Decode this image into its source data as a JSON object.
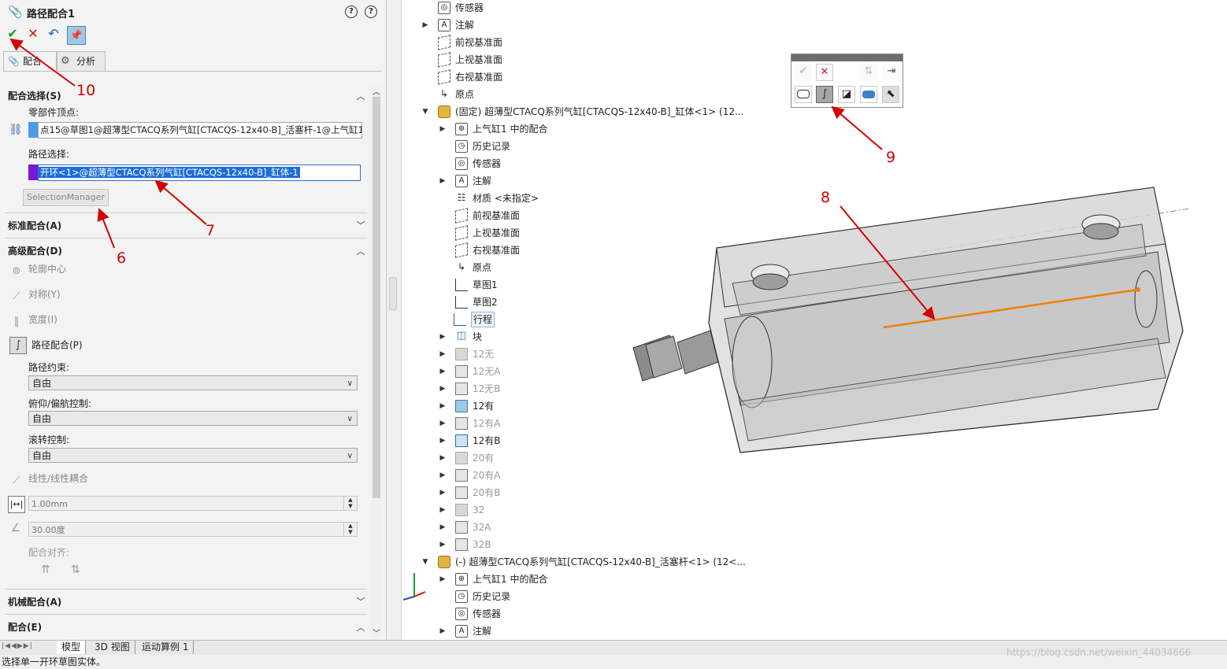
{
  "property_manager": {
    "title": "路径配合1",
    "toolbar": {
      "ok_icon": "check-icon",
      "cancel_icon": "close-icon",
      "undo_icon": "undo-icon",
      "pin_icon": "pushpin-icon"
    },
    "tabs": [
      {
        "label": "配合"
      },
      {
        "label": "分析"
      }
    ],
    "mate_selection": {
      "header": "配合选择(S)",
      "component_vertex_label": "零部件顶点:",
      "component_vertex_value": "点15@草图1@超薄型CTACQ系列气缸[CTACQS-12x40-B]_活塞杆-1@上气缸1",
      "path_label": "路径选择:",
      "path_value": "开环<1>@超薄型CTACQ系列气缸[CTACQS-12x40-B]_缸体-1",
      "selection_manager_label": "SelectionManager"
    },
    "standard_mates": {
      "header": "标准配合(A)"
    },
    "advanced_mates": {
      "header": "高级配合(D)",
      "items": [
        {
          "label": "轮廓中心"
        },
        {
          "label": "对称(Y)"
        },
        {
          "label": "宽度(I)"
        },
        {
          "label": "路径配合(P)"
        }
      ],
      "path_constraint_label": "路径约束:",
      "path_constraint_value": "自由",
      "pitch_yaw_label": "俯仰/偏航控制:",
      "pitch_yaw_value": "自由",
      "roll_label": "滚转控制:",
      "roll_value": "自由",
      "linear_coupler_label": "线性/线性耦合",
      "distance_value": "1.00mm",
      "angle_value": "30.00度",
      "mate_alignment_label": "配合对齐:"
    },
    "mechanical_mates": {
      "header": "机械配合(A)"
    },
    "mates": {
      "header": "配合(E)"
    }
  },
  "tree": {
    "top_items": [
      {
        "label": "传感器"
      },
      {
        "label": "注解"
      },
      {
        "label": "前视基准面"
      },
      {
        "label": "上视基准面"
      },
      {
        "label": "右视基准面"
      },
      {
        "label": "原点"
      }
    ],
    "component1": {
      "label": "(固定) 超薄型CTACQ系列气缸[CTACQS-12x40-B]_缸体<1> (12...",
      "children": [
        {
          "label": "上气缸1 中的配合"
        },
        {
          "label": "历史记录"
        },
        {
          "label": "传感器"
        },
        {
          "label": "注解"
        },
        {
          "label": "材质 <未指定>"
        },
        {
          "label": "前视基准面"
        },
        {
          "label": "上视基准面"
        },
        {
          "label": "右视基准面"
        },
        {
          "label": "原点"
        },
        {
          "label": "草图1"
        },
        {
          "label": "草图2"
        },
        {
          "label": "行程"
        },
        {
          "label": "块"
        },
        {
          "label": "12无"
        },
        {
          "label": "12无A"
        },
        {
          "label": "12无B"
        },
        {
          "label": "12有"
        },
        {
          "label": "12有A"
        },
        {
          "label": "12有B"
        },
        {
          "label": "20有"
        },
        {
          "label": "20有A"
        },
        {
          "label": "20有B"
        },
        {
          "label": "32"
        },
        {
          "label": "32A"
        },
        {
          "label": "32B"
        }
      ]
    },
    "component2": {
      "label": "(-) 超薄型CTACQ系列气缸[CTACQS-12x40-B]_活塞杆<1> (12<...",
      "children": [
        {
          "label": "上气缸1 中的配合"
        },
        {
          "label": "历史记录"
        },
        {
          "label": "传感器"
        },
        {
          "label": "注解"
        }
      ]
    }
  },
  "annotations": [
    "10",
    "7",
    "6",
    "8",
    "9"
  ],
  "bottom_tabs": [
    {
      "label": "模型"
    },
    {
      "label": "3D 视图"
    },
    {
      "label": "运动算例 1"
    }
  ],
  "status_text": "选择单一开环草图实体。",
  "watermark": "https://blog.csdn.net/weixin_44034666"
}
